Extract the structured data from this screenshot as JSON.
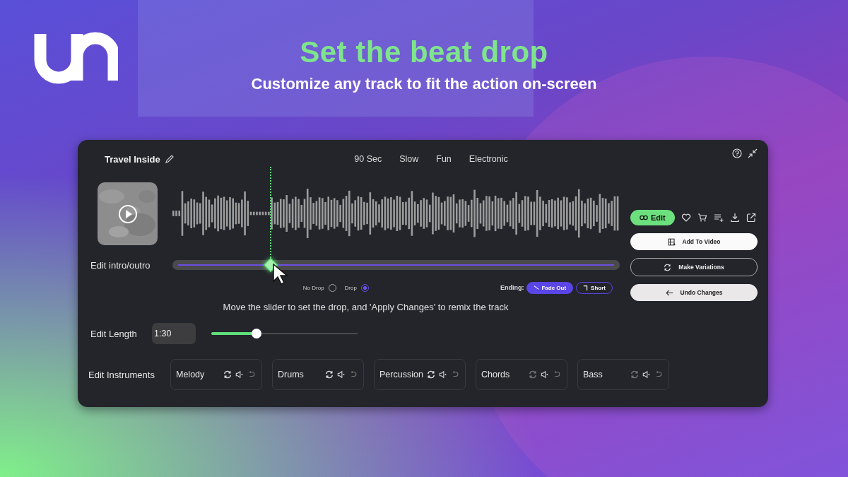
{
  "headline": "Set the beat drop",
  "subheadline": "Customize any track to fit the action on-screen",
  "track": {
    "title": "Travel Inside",
    "tags": [
      "90 Sec",
      "Slow",
      "Fun",
      "Electronic"
    ]
  },
  "intro": {
    "label": "Edit intro/outro",
    "level": 0.22
  },
  "drop_options": [
    {
      "label": "No Drop",
      "selected": false
    },
    {
      "label": "Drop",
      "selected": true
    }
  ],
  "ending": {
    "label": "Ending:",
    "options": [
      {
        "label": "Fade Out",
        "kind": "fade",
        "selected": true
      },
      {
        "label": "Short",
        "kind": "short",
        "selected": false
      }
    ]
  },
  "hint": "Move the slider to set the drop, and 'Apply Changes' to remix the track",
  "length": {
    "label": "Edit Length",
    "value": "1:30",
    "level": 0.31
  },
  "instruments": {
    "label": "Edit Instruments",
    "items": [
      {
        "name": "Melody",
        "shuffle_active": true
      },
      {
        "name": "Drums",
        "shuffle_active": true
      },
      {
        "name": "Percussion",
        "shuffle_active": true
      },
      {
        "name": "Chords",
        "shuffle_active": false
      },
      {
        "name": "Bass",
        "shuffle_active": false
      }
    ]
  },
  "edit_button": "Edit",
  "actions": [
    {
      "label": "Add To Video",
      "kind": "primary"
    },
    {
      "label": "Make Variations",
      "kind": "outline"
    },
    {
      "label": "Undo Changes",
      "kind": "secondary"
    }
  ]
}
